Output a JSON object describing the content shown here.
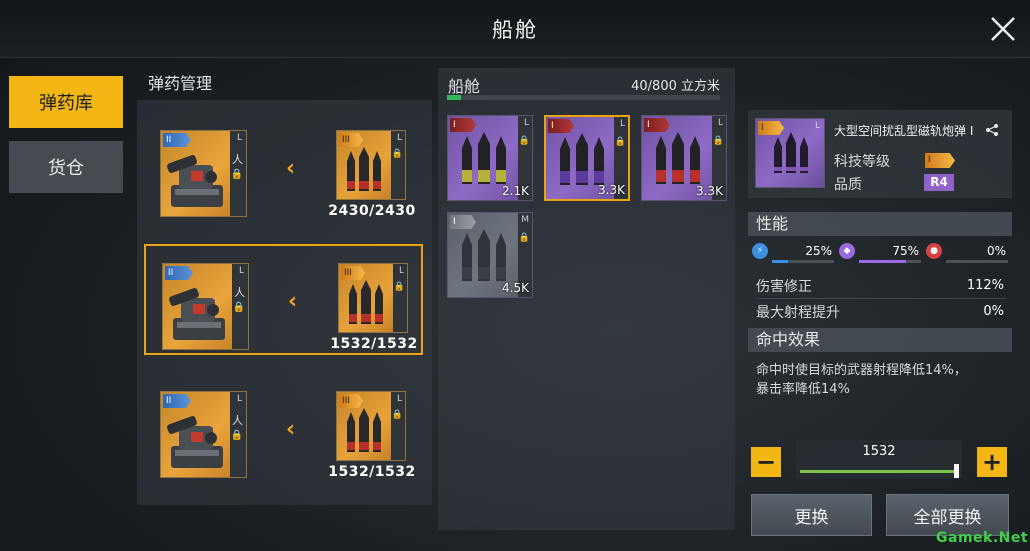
{
  "header": {
    "title": "船舱"
  },
  "tabs": [
    {
      "label": "弹药库",
      "active": true
    },
    {
      "label": "货仓",
      "active": false
    }
  ],
  "ammo_management": {
    "title": "弹药管理",
    "slots": [
      {
        "weapon_rank": "II",
        "weapon_letter": "L",
        "ammo_rank": "III",
        "ammo_letter": "L",
        "count": "2430/2430",
        "selected": false
      },
      {
        "weapon_rank": "II",
        "weapon_letter": "L",
        "ammo_rank": "III",
        "ammo_letter": "L",
        "count": "1532/1532",
        "selected": true
      },
      {
        "weapon_rank": "II",
        "weapon_letter": "L",
        "ammo_rank": "III",
        "ammo_letter": "L",
        "count": "1532/1532",
        "selected": false
      }
    ]
  },
  "cabin": {
    "title": "船舱",
    "capacity": "40/800 立方米",
    "capacity_fraction": 0.05,
    "items": [
      {
        "rank": "I",
        "letter": "L",
        "qty": "2.1K",
        "color": "purple",
        "shell": "yellow",
        "selected": false
      },
      {
        "rank": "I",
        "letter": "L",
        "qty": "3.3K",
        "color": "purple",
        "shell": "purple",
        "selected": true
      },
      {
        "rank": "I",
        "letter": "L",
        "qty": "3.3K",
        "color": "purple",
        "shell": "red",
        "selected": false
      },
      {
        "rank": "I",
        "letter": "M",
        "qty": "4.5K",
        "color": "gray",
        "shell": "dark",
        "selected": false
      }
    ]
  },
  "details": {
    "item_name": "大型空间扰乱型磁轨炮弹 I",
    "item_rank": "I",
    "item_letter": "L",
    "tech_level_label": "科技等级",
    "tech_level_rank": "I",
    "quality_label": "品质",
    "quality_value": "R4",
    "performance_title": "性能",
    "stats": [
      {
        "icon": "lightning-icon",
        "value": "25%",
        "fraction": 0.25,
        "color": "#3d8fe0"
      },
      {
        "icon": "crystal-icon",
        "value": "75%",
        "fraction": 0.75,
        "color": "#9b6ae0"
      },
      {
        "icon": "fire-icon",
        "value": "0%",
        "fraction": 0.0,
        "color": "#d94040"
      }
    ],
    "damage_mod_label": "伤害修正",
    "damage_mod_value": "112%",
    "range_label": "最大射程提升",
    "range_value": "0%",
    "hit_effect_title": "命中效果",
    "hit_effect_text_1": "命中时使目标的武器射程降低14%，",
    "hit_effect_text_2": "暴击率降低14%"
  },
  "quantity": {
    "value": "1532",
    "minus": "−",
    "plus": "+"
  },
  "buttons": {
    "replace": "更换",
    "replace_all": "全部更换"
  },
  "watermark": "Gamek.Net"
}
